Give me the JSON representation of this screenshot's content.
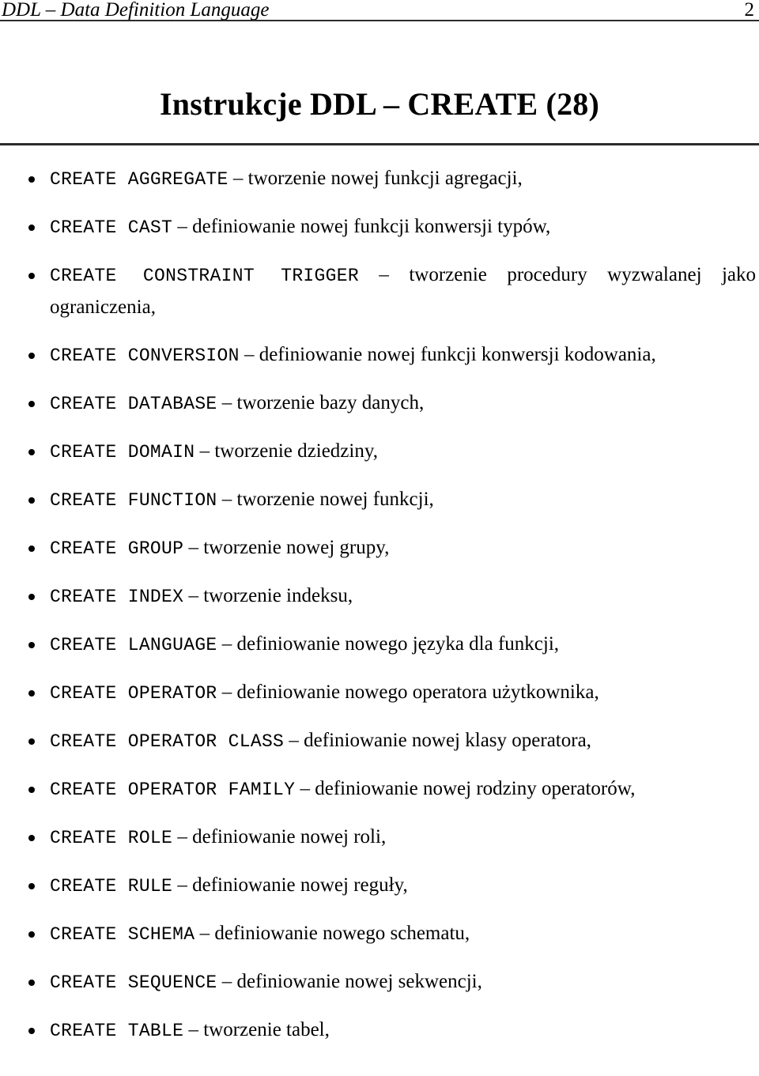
{
  "header": {
    "title": "DDL – Data Definition Language",
    "page_number": "2"
  },
  "slide": {
    "title": "Instrukcje DDL – CREATE (28)"
  },
  "list": {
    "separator": "–",
    "items": [
      {
        "keyword": "CREATE AGGREGATE",
        "description": "– tworzenie nowej funkcji agregacji,"
      },
      {
        "keyword": "CREATE CAST",
        "description": "– definiowanie nowej funkcji konwersji typów,"
      },
      {
        "keyword": "CREATE CONSTRAINT TRIGGER",
        "description": "– tworzenie procedury wyzwalanej jako ograniczenia,"
      },
      {
        "keyword": "CREATE CONVERSION",
        "description": "– definiowanie nowej funkcji konwersji kodowania,"
      },
      {
        "keyword": "CREATE DATABASE",
        "description": "– tworzenie bazy danych,"
      },
      {
        "keyword": "CREATE DOMAIN",
        "description": "– tworzenie dziedziny,"
      },
      {
        "keyword": "CREATE FUNCTION",
        "description": "– tworzenie nowej funkcji,"
      },
      {
        "keyword": "CREATE GROUP",
        "description": "– tworzenie nowej grupy,"
      },
      {
        "keyword": "CREATE INDEX",
        "description": "– tworzenie indeksu,"
      },
      {
        "keyword": "CREATE LANGUAGE",
        "description": "– definiowanie nowego języka dla funkcji,"
      },
      {
        "keyword": "CREATE OPERATOR",
        "description": "– definiowanie nowego operatora użytkownika,"
      },
      {
        "keyword": "CREATE OPERATOR CLASS",
        "description": "– definiowanie nowej klasy operatora,"
      },
      {
        "keyword": "CREATE OPERATOR FAMILY",
        "description": "– definiowanie nowej rodziny operatorów,"
      },
      {
        "keyword": "CREATE ROLE",
        "description": "– definiowanie nowej roli,"
      },
      {
        "keyword": "CREATE RULE",
        "description": "– definiowanie nowej reguły,"
      },
      {
        "keyword": "CREATE SCHEMA",
        "description": "– definiowanie nowego schematu,"
      },
      {
        "keyword": "CREATE SEQUENCE",
        "description": "– definiowanie nowej sekwencji,"
      },
      {
        "keyword": "CREATE TABLE",
        "description": "– tworzenie tabel,"
      }
    ]
  },
  "colors": {
    "text": "#000000",
    "rule": "#2b2b2b",
    "background": "#ffffff"
  }
}
